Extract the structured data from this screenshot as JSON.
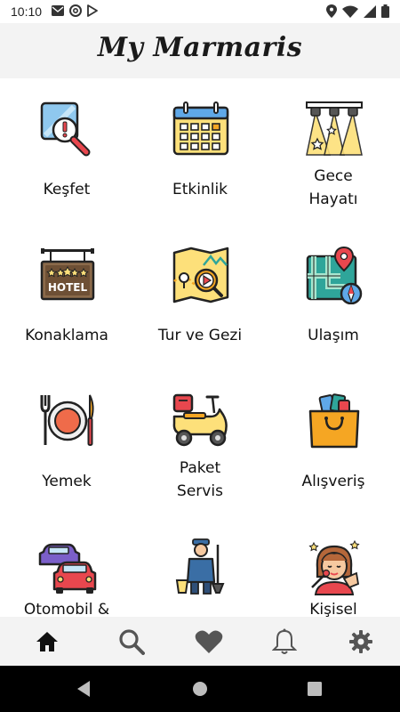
{
  "status_bar": {
    "time": "10:10",
    "left_icons": [
      "mail-icon",
      "at-sign-icon",
      "play-store-icon"
    ],
    "right_icons": [
      "location-icon",
      "wifi-icon",
      "signal-icon",
      "battery-icon"
    ]
  },
  "header": {
    "title": "My Marmaris"
  },
  "tiles": [
    {
      "label": "Keşfet",
      "icon": "magnifier-alert-icon"
    },
    {
      "label": "Etkinlik",
      "icon": "calendar-icon"
    },
    {
      "label": "Gece Hayatı",
      "icon": "stage-lights-icon"
    },
    {
      "label": "Konaklama",
      "icon": "hotel-sign-icon"
    },
    {
      "label": "Tur ve Gezi",
      "icon": "map-video-icon"
    },
    {
      "label": "Ulaşım",
      "icon": "route-map-icon"
    },
    {
      "label": "Yemek",
      "icon": "plate-cutlery-icon"
    },
    {
      "label": "Paket Servis",
      "icon": "delivery-scooter-icon"
    },
    {
      "label": "Alışveriş",
      "icon": "shopping-bag-icon"
    },
    {
      "label": "Otomobil &",
      "icon": "cars-icon"
    },
    {
      "label": "",
      "icon": "cleaner-worker-icon"
    },
    {
      "label": "Kişisel",
      "icon": "beauty-woman-icon"
    }
  ],
  "bottom_nav": [
    {
      "name": "home",
      "icon": "home-icon",
      "active": true
    },
    {
      "name": "search",
      "icon": "search-icon",
      "active": false
    },
    {
      "name": "favorites",
      "icon": "heart-icon",
      "active": false
    },
    {
      "name": "notifications",
      "icon": "bell-icon",
      "active": false
    },
    {
      "name": "settings",
      "icon": "gear-icon",
      "active": false
    }
  ],
  "colors": {
    "header_bg": "#f3f3f3",
    "active_nav": "#111111",
    "inactive_nav": "#555555",
    "icon_yellow": "#fde07a",
    "icon_orange": "#f5a623",
    "icon_red": "#e8474e",
    "icon_blue": "#5fa8e8",
    "icon_teal": "#2fa59a",
    "icon_stroke": "#222222"
  }
}
